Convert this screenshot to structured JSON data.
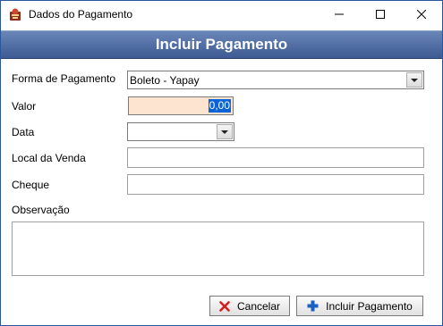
{
  "window": {
    "title": "Dados do Pagamento"
  },
  "header": {
    "title": "Incluir Pagamento"
  },
  "form": {
    "forma_label": "Forma de Pagamento",
    "forma_value": "Boleto - Yapay",
    "valor_label": "Valor",
    "valor_value": "0,00",
    "data_label": "Data",
    "data_value": "",
    "local_label": "Local da Venda",
    "local_value": "",
    "cheque_label": "Cheque",
    "cheque_value": "",
    "obs_label": "Observação",
    "obs_value": ""
  },
  "buttons": {
    "cancel_label": "Cancelar",
    "incluir_label": "Incluir Pagamento"
  },
  "colors": {
    "header_band": "#3d5a92",
    "valor_bg": "#fce4d0",
    "selection": "#0a64d8",
    "cancel_icon": "#d32020",
    "add_icon": "#1a5fc2"
  },
  "icons": {
    "app": "app-icon",
    "minimize": "minimize-icon",
    "maximize": "maximize-icon",
    "close": "close-icon",
    "cancel": "x-icon",
    "add": "plus-icon"
  }
}
